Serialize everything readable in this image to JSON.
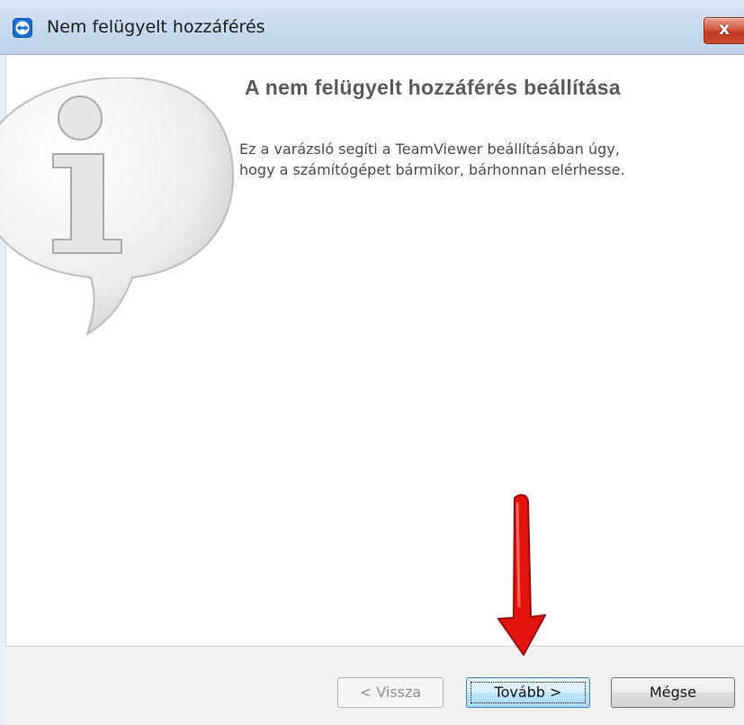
{
  "window": {
    "title": "Nem felügyelt hozzáférés",
    "close_label": "x",
    "app_icon": "teamviewer-icon"
  },
  "main": {
    "heading": "A nem felügyelt hozzáférés beállítása",
    "description_lines": [
      "Ez a varázsló segíti a TeamViewer beállításában úgy,",
      "hogy a számítógépet bármikor, bárhonnan elérhesse."
    ],
    "illustration": "info-speech-bubble-icon"
  },
  "footer": {
    "back_label": "< Vissza",
    "next_label": "Tovább >",
    "cancel_label": "Mégse"
  },
  "annotation": {
    "arrow": "red-arrow-icon",
    "arrow_color": "#e3130f"
  },
  "colors": {
    "titlebar": "#c8daee",
    "close_button": "#c94a30",
    "default_button_border": "#3c7fb1",
    "heading_text": "#5a5a5a"
  }
}
